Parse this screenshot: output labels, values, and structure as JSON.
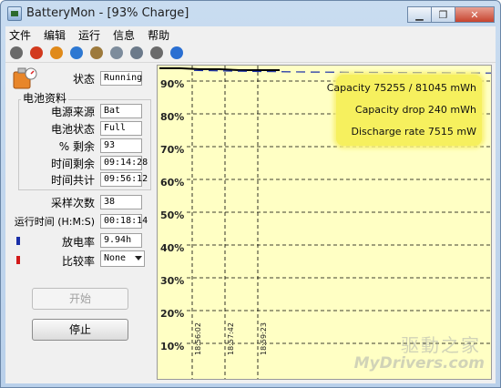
{
  "window": {
    "title": "BatteryMon - [93% Charge]"
  },
  "window_buttons": {
    "minimize": "▁",
    "restore": "❐",
    "close": "✕"
  },
  "menu": [
    "文件",
    "编辑",
    "运行",
    "信息",
    "帮助"
  ],
  "toolbar_icons": [
    {
      "name": "check-icon",
      "color": "#6a6a6a"
    },
    {
      "name": "stop-icon",
      "color": "#d23a1e"
    },
    {
      "name": "battery-icon",
      "color": "#e08a1a"
    },
    {
      "name": "info-icon",
      "color": "#2d78d2"
    },
    {
      "name": "clipboard-icon",
      "color": "#9d7a3c"
    },
    {
      "name": "gauge-icon",
      "color": "#7d8c9c"
    },
    {
      "name": "tools-icon",
      "color": "#6c7a8a"
    },
    {
      "name": "settings-icon",
      "color": "#6b6b6b"
    },
    {
      "name": "help-icon",
      "color": "#2a6fd2"
    }
  ],
  "status": {
    "label": "状态",
    "value": "Running"
  },
  "battery_info": {
    "group_title": "电池资料",
    "power_source": {
      "label": "电源来源",
      "value": "Bat"
    },
    "battery_status": {
      "label": "电池状态",
      "value": "Full"
    },
    "percent_left": {
      "label": "% 剩余",
      "value": "93"
    },
    "time_left": {
      "label": "时间剩余",
      "value": "09:14:28"
    },
    "time_total": {
      "label": "时间共计",
      "value": "09:56:12"
    }
  },
  "sample_count": {
    "label": "采样次数",
    "value": "38"
  },
  "run_time": {
    "label": "运行时间 (H:M:S)",
    "value": "00:18:14"
  },
  "discharge_rate": {
    "label": "放电率",
    "value": "9.94h",
    "marker_color": "#1a2fa8"
  },
  "compare_rate": {
    "label": "比较率",
    "value": "None",
    "marker_color": "#d21a1a"
  },
  "buttons": {
    "start": "开始",
    "stop": "停止"
  },
  "legend": {
    "capacity": "Capacity 75255 / 81045 mWh",
    "capacity_drop": "Capacity drop 240 mWh",
    "discharge": "Discharge rate 7515 mW"
  },
  "watermark": {
    "cn": "驱動之家",
    "en": "MyDrivers.com"
  },
  "chart_data": {
    "type": "line",
    "title": "",
    "xlabel": "",
    "ylabel": "",
    "y_ticks": [
      "90%",
      "80%",
      "70%",
      "60%",
      "50%",
      "40%",
      "30%",
      "20%",
      "10%"
    ],
    "x_ticks": [
      "18:56:02",
      "18:57:42",
      "18:59:23"
    ],
    "ylim": [
      5,
      95
    ],
    "grid": true,
    "background_color": "#ffffc4",
    "series": [
      {
        "values": [
          94.2,
          94.2,
          93.9,
          93.9,
          93.6,
          93.6,
          93.6
        ],
        "color": "#000000"
      },
      {
        "values": [
          93.8,
          93.5,
          93.3,
          93.2,
          93.1,
          93.0
        ],
        "color": "#1a2fa8"
      }
    ]
  }
}
